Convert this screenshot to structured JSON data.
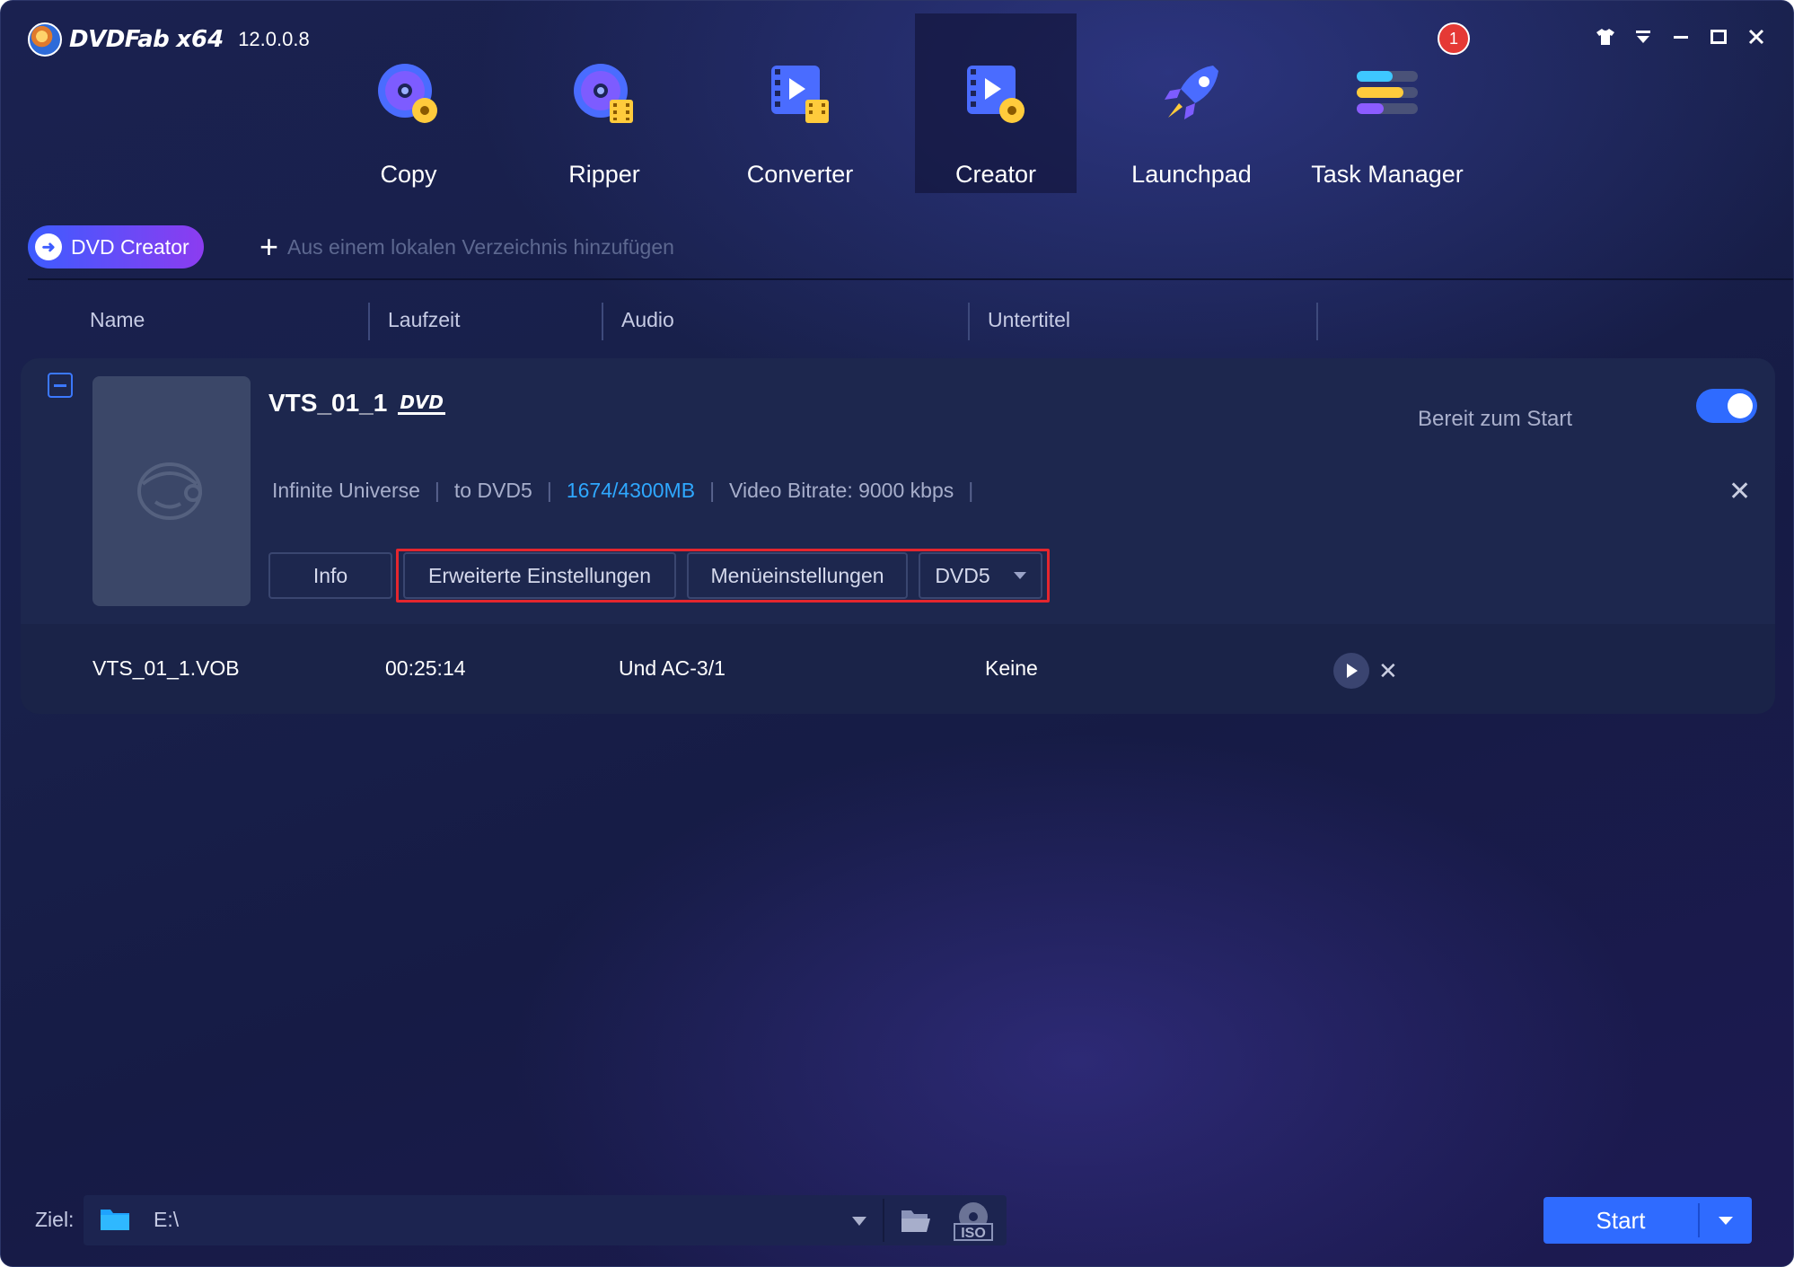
{
  "app": {
    "brand": "DVDFab",
    "arch": "x64",
    "version": "12.0.0.8",
    "notification_count": "1"
  },
  "nav": {
    "items": [
      {
        "label": "Copy",
        "icon": "copy-disc-icon"
      },
      {
        "label": "Ripper",
        "icon": "ripper-disc-icon"
      },
      {
        "label": "Converter",
        "icon": "converter-film-icon"
      },
      {
        "label": "Creator",
        "icon": "creator-film-disc-icon",
        "active": true
      },
      {
        "label": "Launchpad",
        "icon": "rocket-icon"
      },
      {
        "label": "Task Manager",
        "icon": "task-list-icon"
      }
    ]
  },
  "toolbar": {
    "mode_label": "DVD Creator",
    "add_label": "Aus einem lokalen Verzeichnis hinzufügen"
  },
  "table": {
    "headers": [
      "Name",
      "Laufzeit",
      "Audio",
      "Untertitel"
    ]
  },
  "task": {
    "title": "VTS_01_1",
    "format_logo": "DVD",
    "status": "Bereit zum Start",
    "enabled": true,
    "meta": {
      "source": "Infinite Universe",
      "target": "to DVD5",
      "size": "1674/4300MB",
      "bitrate": "Video Bitrate: 9000 kbps"
    },
    "buttons": {
      "info": "Info",
      "advanced": "Erweiterte Einstellungen",
      "menu": "Menüeinstellungen",
      "disc_type": "DVD5"
    },
    "files": [
      {
        "name": "VTS_01_1.VOB",
        "duration": "00:25:14",
        "audio": "Und  AC-3/1",
        "subtitle": "Keine"
      }
    ]
  },
  "bottom": {
    "target_label": "Ziel:",
    "target_path": "E:\\",
    "iso_label": "ISO",
    "start_label": "Start"
  },
  "colors": {
    "accent": "#2f6bff",
    "highlight_border": "#e4262e",
    "size_text": "#2fa8ff",
    "badge": "#e53935"
  }
}
